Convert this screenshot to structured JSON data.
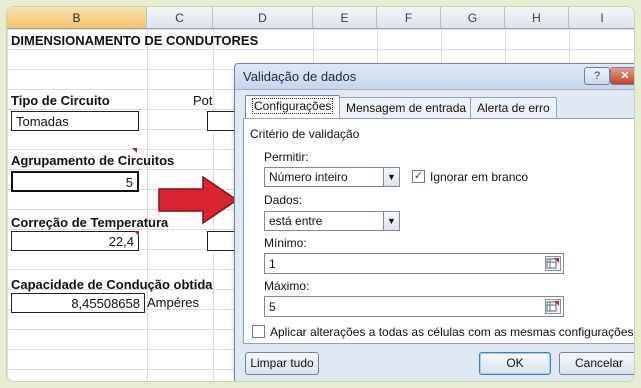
{
  "columns": [
    "B",
    "C",
    "D",
    "E",
    "F",
    "G",
    "H",
    "I"
  ],
  "sheet": {
    "title": "DIMENSIONAMENTO DE CONDUTORES",
    "tipo_label": "Tipo de Circuito",
    "tipo_value": "Tomadas",
    "pot_label_partial": "Pot",
    "agrupamento_label": "Agrupamento de Circuitos",
    "agrupamento_value": "5",
    "correcao_label": "Correção de Temperatura",
    "correcao_value": "22,4",
    "capacidade_label": "Capacidade de Condução obtida",
    "capacidade_value": "8,45508658",
    "capacidade_unit": "Ampéres"
  },
  "dialog": {
    "title": "Validação de dados",
    "help_label": "?",
    "close_label": "✕",
    "tabs": [
      "Configurações",
      "Mensagem de entrada",
      "Alerta de erro"
    ],
    "criterio_label": "Critério de validação",
    "permitir_label": "Permitir:",
    "permitir_value": "Número inteiro",
    "ignorar_label": "Ignorar em branco",
    "ignorar_checked": true,
    "dados_label": "Dados:",
    "dados_value": "está entre",
    "minimo_label": "Mínimo:",
    "minimo_value": "1",
    "maximo_label": "Máximo:",
    "maximo_value": "5",
    "aplicar_label": "Aplicar alterações a todas as células com as mesmas configurações",
    "aplicar_checked": false,
    "limpar_label": "Limpar tudo",
    "ok_label": "OK",
    "cancelar_label": "Cancelar"
  },
  "colors": {
    "arrow": "#d9262e",
    "background": "#e6edd3",
    "dialog": "#dfe8f3"
  },
  "icons": [
    "dropdown-arrow-icon",
    "checkmark-icon",
    "range-picker-icon",
    "red-arrow-icon"
  ]
}
